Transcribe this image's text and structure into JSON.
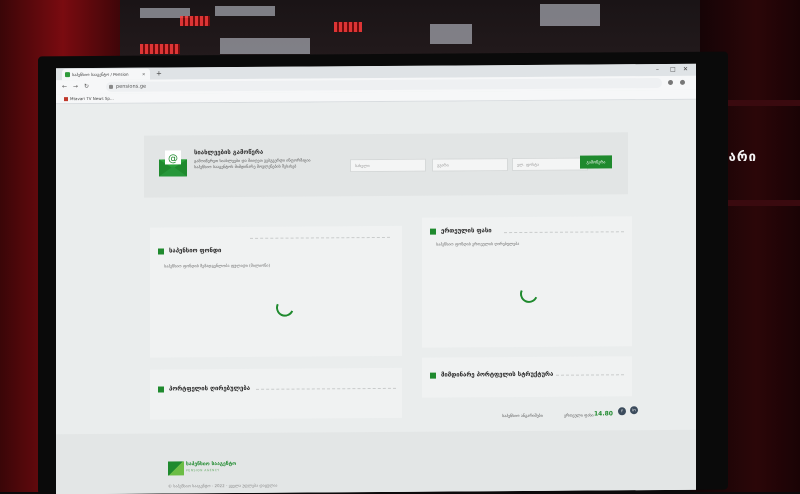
{
  "browser": {
    "tab_title": "საპენსიო სააგენტო / Pension",
    "new_tab": "+",
    "url": "pensions.ge",
    "bookmark": "Mtavari TV News Sp...",
    "window_controls": [
      "–",
      "□",
      "✕"
    ]
  },
  "newsletter": {
    "title": "სიახლეების გამოწერა",
    "description": "გამოიწერეთ სიახლეები და მიიღეთ ვებგვერდი ინფორმაცია საპენსიო სააგენტოს მიმდინარე მოვლენების შესახებ",
    "fields": [
      {
        "placeholder": "სახელი"
      },
      {
        "placeholder": "გვარი"
      },
      {
        "placeholder": "ელ. ფოსტა"
      }
    ],
    "button": "გამოწერა",
    "icon": "envelope-at-icon"
  },
  "cards": {
    "pension_list": {
      "title": "საპენსიო ფონდი",
      "subtitle": "საპენსიო ფონდის შემადგენლობა ფულადი (მილიონი)"
    },
    "portfolio_return": {
      "title": "პორტფელის ღირებულება",
      "subtitle": ""
    },
    "unit_price": {
      "title": "ერთეულის ფასი",
      "subtitle": "საპენსიო ფონდის ერთეულის ღირებულება"
    },
    "portfolio_allocation": {
      "title": "მიმდინარე პორტფელის სტრუქტურა",
      "subtitle": ""
    }
  },
  "stats": {
    "label": "საპენსიო ანგარიშები",
    "price_label": "ერთეული ფასი",
    "price_value": "14.80"
  },
  "social": [
    "f",
    "in"
  ],
  "footer": {
    "logo_text": "საპენსიო სააგენტო",
    "logo_sub": "PENSION AGENCY",
    "copyright": "© საპენსიო სააგენტო - 2022 - ყველა უფლება დაცულია"
  },
  "tv": {
    "channel": "მთავარი"
  },
  "colors": {
    "accent": "#1f8a2e",
    "page_bg": "#eaeded"
  }
}
